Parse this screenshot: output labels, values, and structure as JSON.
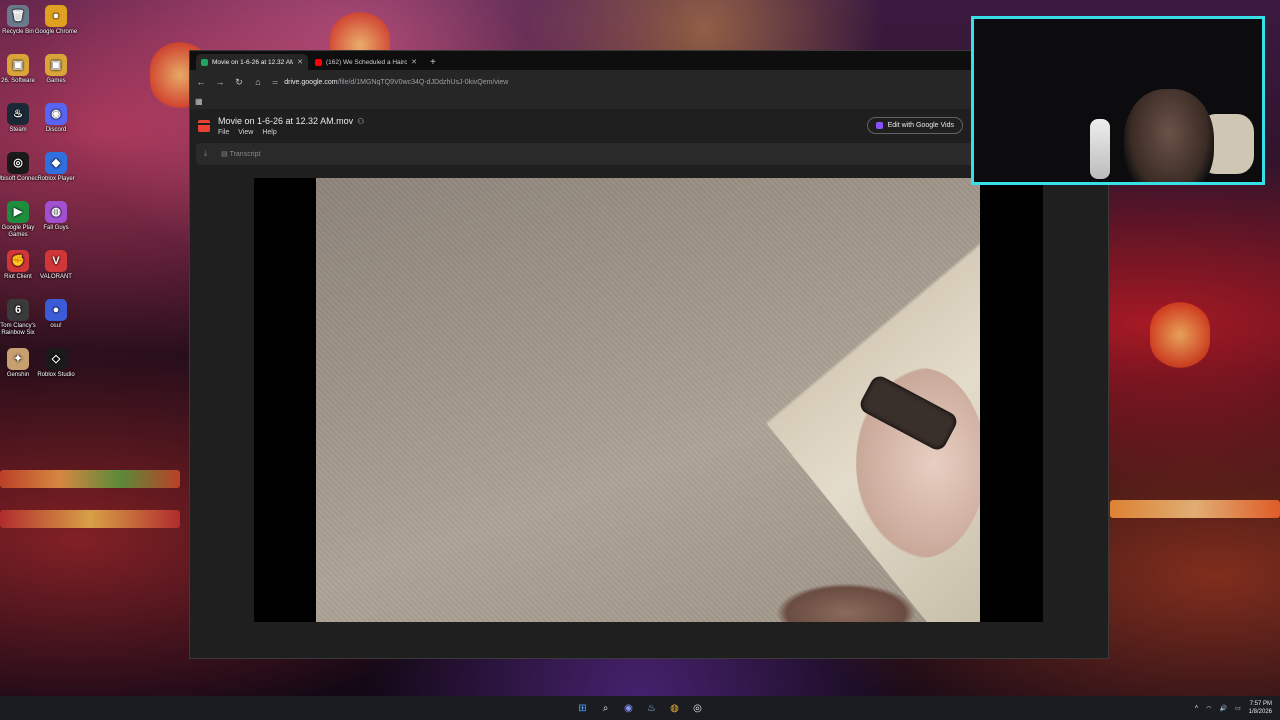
{
  "desktop": {
    "icons": [
      {
        "label": "Recycle Bin",
        "glyph": "🗑",
        "color": "#6a7a8c"
      },
      {
        "label": "Google Chrome",
        "glyph": "●",
        "color": "#e0a020"
      },
      {
        "label": "26. Software",
        "glyph": "▣",
        "color": "#d9a43a"
      },
      {
        "label": "Games",
        "glyph": "▣",
        "color": "#d9a43a"
      },
      {
        "label": "Steam",
        "glyph": "♨",
        "color": "#1b2838"
      },
      {
        "label": "Discord",
        "glyph": "◉",
        "color": "#5865f2"
      },
      {
        "label": "Ubisoft Connect",
        "glyph": "◎",
        "color": "#1a1a1a"
      },
      {
        "label": "Roblox Player",
        "glyph": "◆",
        "color": "#2f6fe0"
      },
      {
        "label": "Google Play Games",
        "glyph": "▶",
        "color": "#1e8e3e"
      },
      {
        "label": "Fall Guys",
        "glyph": "◍",
        "color": "#a050d0"
      },
      {
        "label": "Riot Client",
        "glyph": "✊",
        "color": "#d13639"
      },
      {
        "label": "VALORANT",
        "glyph": "V",
        "color": "#d13639"
      },
      {
        "label": "Tom Clancy's Rainbow Six",
        "glyph": "6",
        "color": "#3a3a3a"
      },
      {
        "label": "osu!",
        "glyph": "●",
        "color": "#3b5bd9"
      },
      {
        "label": "Genshin",
        "glyph": "✦",
        "color": "#c8a070"
      },
      {
        "label": "Roblox Studio",
        "glyph": "◇",
        "color": "#1a1a1a"
      }
    ]
  },
  "browser": {
    "tabs": [
      {
        "title": "Movie on 1-6-26 at 12.32 AM.m",
        "favicon_color": "#1fa463",
        "active": true,
        "close": "✕"
      },
      {
        "title": "(162) We Scheduled a Haircut W",
        "favicon_color": "#ff0000",
        "active": false,
        "close": "✕"
      }
    ],
    "new_tab": "+",
    "nav": {
      "back": "←",
      "forward": "→",
      "reload": "↻",
      "home": "⌂"
    },
    "address": {
      "host": "drive.google.com",
      "path": "/file/d/1MGNqTQ9V0wc34Q-dJDdzhUsJ-0kivQem/view"
    },
    "apps_icon": "▦"
  },
  "drive": {
    "file_title": "Movie on 1-6-26 at 12.32 AM.mov",
    "menu": [
      "File",
      "View",
      "Help"
    ],
    "share_icon": "⚇",
    "edit_vids_label": "Edit with Google Vids",
    "toolbar": {
      "download_icon": "⤓",
      "transcript_label": "Transcript"
    }
  },
  "taskbar": {
    "icons": [
      "⊞",
      "⌕",
      "◉",
      "♨",
      "◍",
      "◎"
    ],
    "tray": {
      "chevron": "˄",
      "wifi": "◠",
      "volume": "🔊",
      "battery": "▭"
    },
    "time": "7:57 PM",
    "date": "1/8/2026"
  }
}
